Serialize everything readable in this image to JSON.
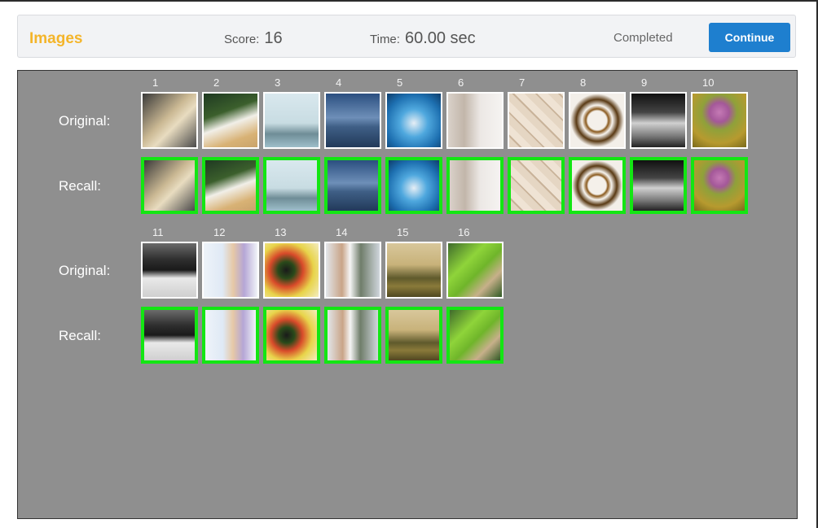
{
  "header": {
    "title": "Images",
    "score_label": "Score:",
    "score_value": "16",
    "time_label": "Time:",
    "time_value": "60.00 sec",
    "status": "Completed",
    "continue_label": "Continue"
  },
  "board": {
    "original_label": "Original:",
    "recall_label": "Recall:",
    "recall_border_color": "#13e613",
    "items": [
      {
        "number": "1",
        "image": "book-cover-photo",
        "bg": "linear-gradient(135deg,#3a3a3a 0%,#cbb994 45%,#e8dcc0 60%,#4a4a4a 100%)"
      },
      {
        "number": "2",
        "image": "tea-and-bread-photo",
        "bg": "linear-gradient(160deg,#1f3a22 0%,#3b5f2c 35%,#f1efe8 55%,#d8b275 80%,#c9a36a 100%)"
      },
      {
        "number": "3",
        "image": "sailing-ship-photo",
        "bg": "linear-gradient(180deg,#d9e8ee 0%,#c8dce2 55%,#6f8d97 75%,#9ebfca 100%)"
      },
      {
        "number": "4",
        "image": "pier-seascape-photo",
        "bg": "linear-gradient(180deg,#2b4f80 0%,#6e8fb8 45%,#3f5f86 62%,#223a5a 100%)"
      },
      {
        "number": "5",
        "image": "blue-circular-office-photo",
        "bg": "radial-gradient(circle at 50% 55%,#e6eef5 0%,#4fa8de 35%,#1d6fb0 70%,#0e3d6b 100%)"
      },
      {
        "number": "6",
        "image": "stone-statue-photo",
        "bg": "linear-gradient(90deg,#d9d1c9 0%,#c2b6aa 30%,#ece8e5 60%,#f5f3f1 100%)"
      },
      {
        "number": "7",
        "image": "stone-wall-texture-photo",
        "bg": "repeating-linear-gradient(45deg,#e5d6c3 0 9px,#c9b39a 9px 11px,#efe3d4 11px 20px)"
      },
      {
        "number": "8",
        "image": "bead-bracelet-photo",
        "bg": "radial-gradient(circle at 50% 50%,#f4f0ea 0%,#f4f0ea 25%,#8a5a1e 30%,#f7f4ef 40%,#5a3a14 55%,#f3efe9 70%)"
      },
      {
        "number": "9",
        "image": "dog-on-road-photo",
        "bg": "linear-gradient(180deg,#111 0%,#444 35%,#d0d0d0 55%,#777 80%,#222 100%)"
      },
      {
        "number": "10",
        "image": "allium-flower-photo",
        "bg": "radial-gradient(circle at 50% 35%,#c57ab5 0%,#a45899 22%,#8fa13a 40%,#b79a2f 70%,#7a6a1c 100%)"
      },
      {
        "number": "11",
        "image": "black-bird-sculpture-photo",
        "bg": "linear-gradient(180deg,#6b6b6b 0%,#2f2f2f 30%,#1a1a1a 50%,#e9e9e9 65%,#cfcfcf 100%)"
      },
      {
        "number": "12",
        "image": "child-at-whiteboard-photo",
        "bg": "linear-gradient(90deg,#eef3f9 0%,#dfe9f5 35%,#e6c8a6 55%,#b5a6d6 75%,#f1f4f8 100%)"
      },
      {
        "number": "13",
        "image": "molecule-model-photo",
        "bg": "radial-gradient(circle at 40% 50%,#1a1a1a 0%,#2a4a1a 20%,#d84a2a 40%,#e8d44a 65%,#f3ecc0 100%)"
      },
      {
        "number": "14",
        "image": "engineers-meeting-photo",
        "bg": "linear-gradient(90deg,#e2e6ea 0%,#c9a487 30%,#f5f5f5 45%,#6f7d6a 65%,#d0d6dc 100%)"
      },
      {
        "number": "15",
        "image": "countryside-hill-photo",
        "bg": "linear-gradient(180deg,#d8c79b 0%,#c8b27a 40%,#5f5a2c 65%,#8a7a3a 80%,#4f4820 100%)"
      },
      {
        "number": "16",
        "image": "parakeets-photo",
        "bg": "linear-gradient(135deg,#3f6b2c 0%,#8fd43a 35%,#6fb52a 55%,#c7b08a 75%,#2f5a24 100%)"
      }
    ]
  }
}
